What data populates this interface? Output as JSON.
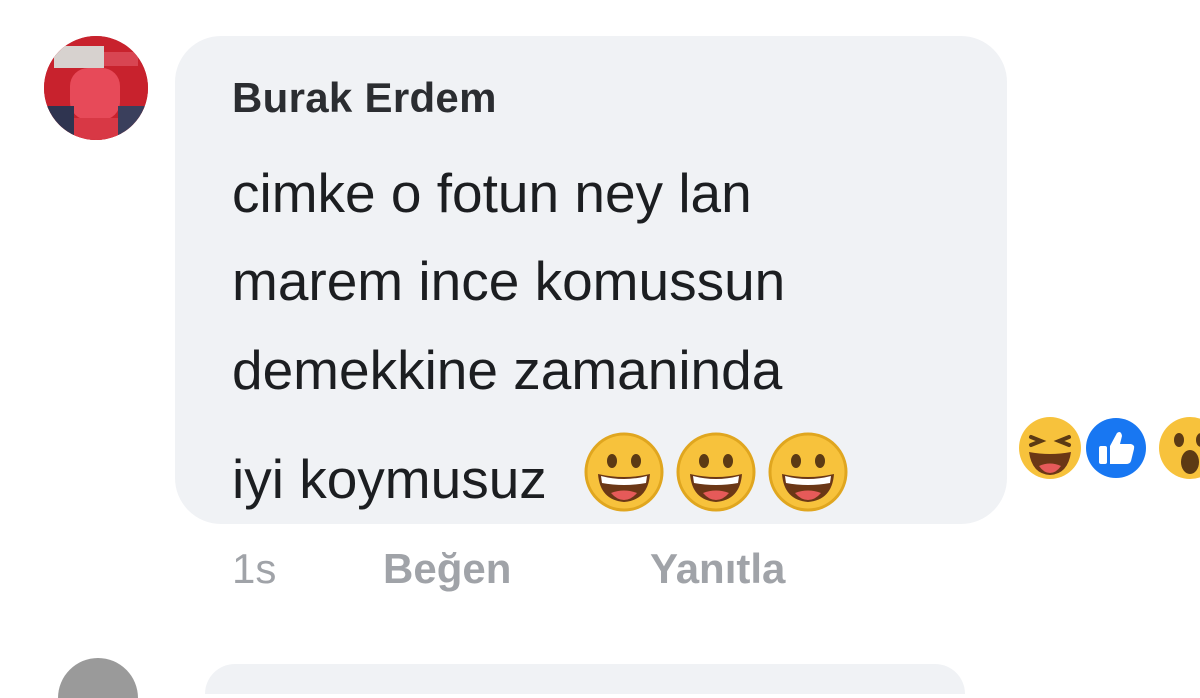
{
  "comment": {
    "author": "Burak Erdem",
    "lines": [
      "cimke o fotun ney lan",
      "marem ince komussun",
      "demekkine zamaninda",
      "iyi koymusuz"
    ],
    "emojis": [
      "grinning-face-icon",
      "grinning-face-icon",
      "grinning-face-icon"
    ],
    "time": "1s",
    "actions": {
      "like": "Beğen",
      "reply": "Yanıtla"
    }
  },
  "reactions": [
    "laughing-face-icon",
    "like-thumb-icon",
    "wow-face-icon"
  ],
  "colors": {
    "bubble": "#f0f2f5",
    "action_text": "#a0a3a8",
    "like_blue": "#1877f2",
    "emoji_yellow": "#f7c23c"
  }
}
